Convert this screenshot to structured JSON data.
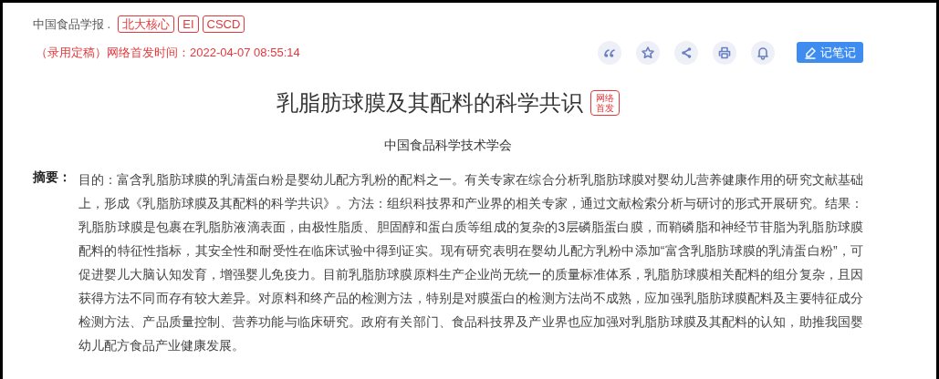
{
  "journal": {
    "name": "中国食品学报 .",
    "tags": [
      "北大核心",
      "EI",
      "CSCD"
    ]
  },
  "publish_info": "（录用定稿）网络首发时间：2022-04-07 08:55:14",
  "actions": [
    {
      "kind": "quote"
    },
    {
      "kind": "star"
    },
    {
      "kind": "share"
    },
    {
      "kind": "print"
    },
    {
      "kind": "bell"
    }
  ],
  "note_button": "记笔记",
  "title": "乳脂肪球膜及其配料的科学共识",
  "title_badge": "网络首发",
  "author": "中国食品科学技术学会",
  "abstract": {
    "label": "摘要：",
    "text": "目的：富含乳脂肪球膜的乳清蛋白粉是婴幼儿配方乳粉的配料之一。有关专家在综合分析乳脂肪球膜对婴幼儿营养健康作用的研究文献基础上，形成《乳脂肪球膜及其配料的科学共识》。方法：组织科技界和产业界的相关专家，通过文献检索分析与研讨的形式开展研究。结果：乳脂肪球膜是包裹在乳脂肪液滴表面，由极性脂质、胆固醇和蛋白质等组成的复杂的3层磷脂蛋白膜，而鞘磷脂和神经节苷脂为乳脂肪球膜配料的特征性指标，其安全性和耐受性在临床试验中得到证实。现有研究表明在婴幼儿配方乳粉中添加“富含乳脂肪球膜的乳清蛋白粉”，可促进婴儿大脑认知发育，增强婴儿免疫力。目前乳脂肪球膜原料生产企业尚无统一的质量标准体系，乳脂肪球膜相关配料的组分复杂，且因获得方法不同而存有较大差异。对原料和终产品的检测方法，特别是对膜蛋白的检测方法尚不成熟，应加强乳脂肪球膜配料及主要特征成分检测方法、产品质量控制、营养功能与临床研究。政府有关部门、食品科技界及产业界也应加强对乳脂肪球膜及其配料的认知，助推我国婴幼儿配方食品产业健康发展。"
  }
}
